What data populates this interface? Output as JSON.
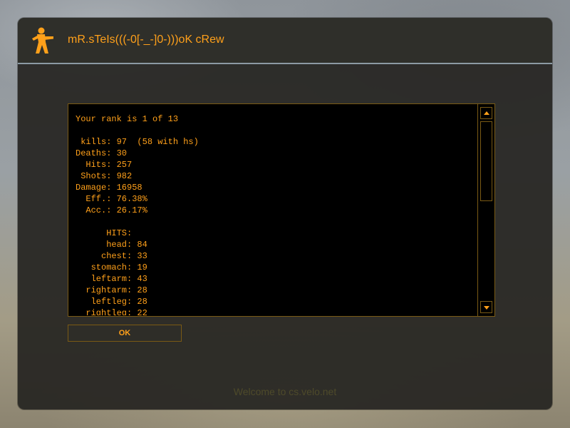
{
  "window": {
    "title": "mR.sTeIs(((-0[-_-]0-)))oK cRew",
    "logo_icon": "counter-strike-soldier-icon"
  },
  "motd": {
    "lines": [
      "Your rank is 1 of 13",
      "",
      " kills: 97  (58 with hs)",
      "Deaths: 30",
      "  Hits: 257",
      " Shots: 982",
      "Damage: 16958",
      "  Eff.: 76.38%",
      "  Acc.: 26.17%",
      "",
      "      HITS:",
      "      head: 84",
      "     chest: 33",
      "   stomach: 19",
      "   leftarm: 43",
      "  rightarm: 28",
      "   leftleg: 28",
      "  rightleg: 22"
    ]
  },
  "scrollbar": {
    "up_icon": "scroll-up-arrow-icon",
    "down_icon": "scroll-down-arrow-icon"
  },
  "buttons": {
    "ok_label": "OK"
  },
  "footer": {
    "text": "Welcome to cs.velo.net"
  },
  "colors": {
    "accent": "#ffa01a",
    "border": "#7a5a14",
    "panel_bg": "#000000"
  }
}
